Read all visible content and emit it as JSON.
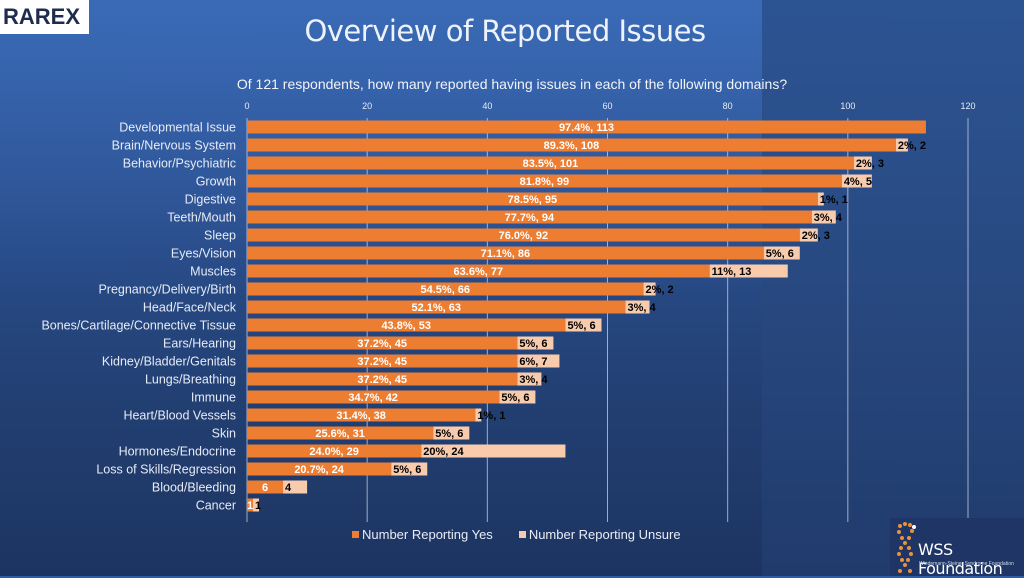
{
  "branding": {
    "left_logo": "RAREX",
    "right_logo_name": "WSS Foundation",
    "right_logo_sub": "Wiedemann-Steiner Syndrome Foundation"
  },
  "page": {
    "title": "Overview of Reported Issues"
  },
  "colors": {
    "yes": "#ed7d31",
    "unsure": "#f8cbad",
    "grid": "#c9d3e6",
    "axis_text": "#e6ebf5",
    "label_text": "#e6ebf5",
    "yes_label": "#ffffff",
    "unsure_label": "#000000"
  },
  "chart_data": {
    "type": "bar",
    "orientation": "horizontal",
    "stacked": true,
    "title": "Of 121 respondents, how many reported having issues in each of the following domains?",
    "xlabel": "",
    "ylabel": "",
    "xlim": [
      0,
      120
    ],
    "x_ticks": [
      "0",
      "20",
      "40",
      "60",
      "80",
      "100",
      "120"
    ],
    "x_tick_values": [
      0,
      20,
      40,
      60,
      80,
      100,
      120
    ],
    "grid": true,
    "x_axis_position": "top",
    "legend_position": "bottom",
    "categories": [
      "Developmental Issue",
      "Brain/Nervous System",
      "Behavior/Psychiatric",
      "Growth",
      "Digestive",
      "Teeth/Mouth",
      "Sleep",
      "Eyes/Vision",
      "Muscles",
      "Pregnancy/Delivery/Birth",
      "Head/Face/Neck",
      "Bones/Cartilage/Connective Tissue",
      "Ears/Hearing",
      "Kidney/Bladder/Genitals",
      "Lungs/Breathing",
      "Immune",
      "Heart/Blood Vessels",
      "Skin",
      "Hormones/Endocrine",
      "Loss of Skills/Regression",
      "Blood/Bleeding",
      "Cancer"
    ],
    "series": [
      {
        "name": "Number Reporting Yes",
        "values": [
          113,
          108,
          101,
          99,
          95,
          94,
          92,
          86,
          77,
          66,
          63,
          53,
          45,
          45,
          45,
          42,
          38,
          31,
          29,
          24,
          6,
          1
        ],
        "labels": [
          "97.4%, 113",
          "89.3%, 108",
          "83.5%, 101",
          "81.8%, 99",
          "78.5%, 95",
          "77.7%, 94",
          "76.0%, 92",
          "71.1%, 86",
          "63.6%, 77",
          "54.5%, 66",
          "52.1%, 63",
          "43.8%, 53",
          "37.2%, 45",
          "37.2%, 45",
          "37.2%, 45",
          "34.7%, 42",
          "31.4%, 38",
          "25.6%, 31",
          "24.0%, 29",
          "20.7%, 24",
          "6",
          "1"
        ]
      },
      {
        "name": "Number Reporting Unsure",
        "values": [
          0,
          2,
          3,
          5,
          1,
          4,
          3,
          6,
          13,
          2,
          4,
          6,
          6,
          7,
          4,
          6,
          1,
          6,
          24,
          6,
          4,
          1
        ],
        "labels": [
          "",
          "2%, 2",
          "2%, 3",
          "4%, 5",
          "1%, 1",
          "3%, 4",
          "2%, 3",
          "5%, 6",
          "11%, 13",
          "2%, 2",
          "3%, 4",
          "5%, 6",
          "5%, 6",
          "6%, 7",
          "3%, 4",
          "5%, 6",
          "1%, 1",
          "5%, 6",
          "20%, 24",
          "5%, 6",
          "4",
          "1"
        ]
      }
    ]
  }
}
